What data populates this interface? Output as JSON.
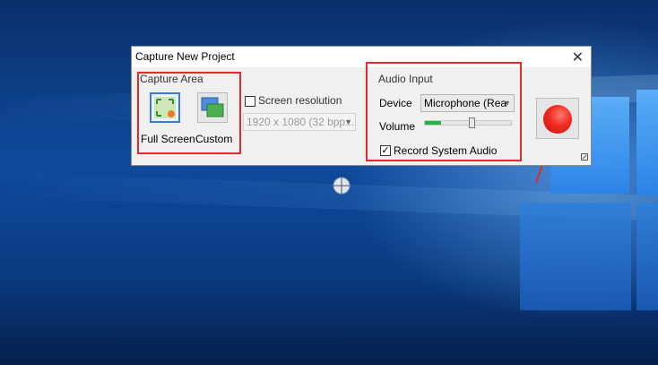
{
  "dialog": {
    "title": "Capture New Project",
    "close_icon": "close-icon"
  },
  "capture_area": {
    "label": "Capture Area",
    "full_screen_label": "Full Screen",
    "custom_label": "Custom",
    "screen_resolution_label": "Screen resolution",
    "screen_resolution_checked": false,
    "resolution_value": "1920 x 1080 (32 bpp..."
  },
  "audio_input": {
    "label": "Audio Input",
    "device_label": "Device",
    "device_value": "Microphone (Rea",
    "volume_label": "Volume",
    "volume_level_fraction": 0.55,
    "record_system_audio_label": "Record System Audio",
    "record_system_audio_checked": true
  },
  "colors": {
    "highlight": "#e22b2b",
    "record": "#ef2a1f",
    "level": "#24b24a"
  }
}
